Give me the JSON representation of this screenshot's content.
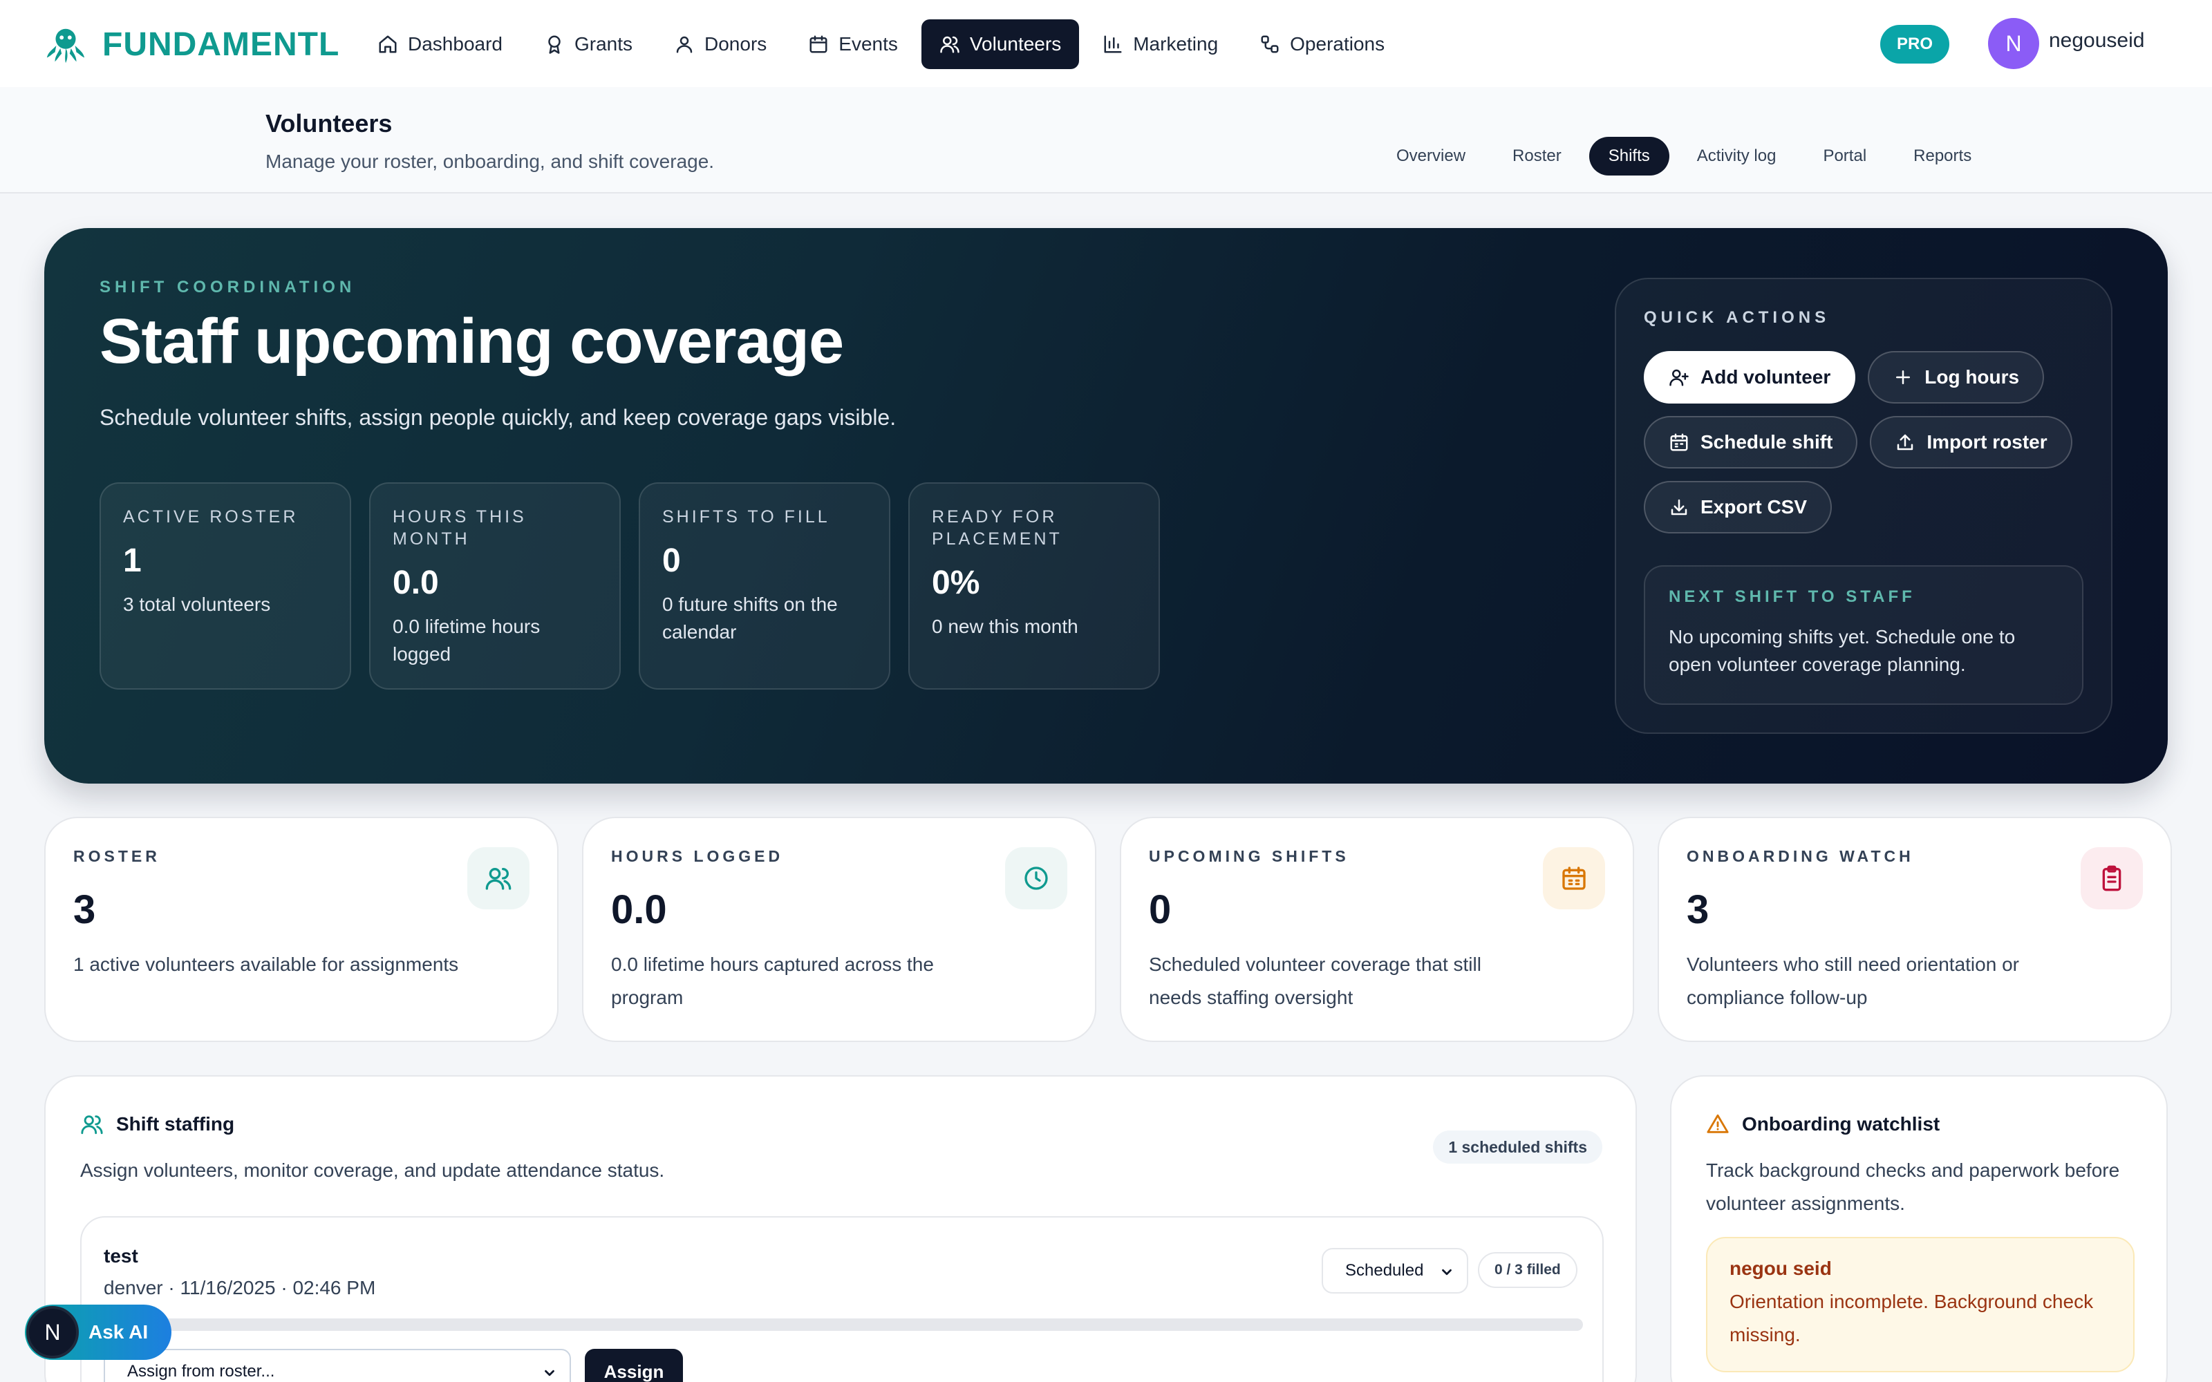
{
  "brand": {
    "name": "FUNDAMENTL",
    "color": "#0f9a8f"
  },
  "nav": {
    "items": [
      {
        "label": "Dashboard",
        "icon": "home-icon"
      },
      {
        "label": "Grants",
        "icon": "award-icon"
      },
      {
        "label": "Donors",
        "icon": "user-icon"
      },
      {
        "label": "Events",
        "icon": "calendar-icon"
      },
      {
        "label": "Volunteers",
        "icon": "users-icon",
        "active": true
      },
      {
        "label": "Marketing",
        "icon": "bar-chart-icon"
      },
      {
        "label": "Operations",
        "icon": "workflow-icon"
      }
    ],
    "pro_badge": "PRO",
    "avatar_initial": "N",
    "username": "negouseid"
  },
  "page": {
    "title": "Volunteers",
    "subtitle": "Manage your roster, onboarding, and shift coverage.",
    "tabs": [
      "Overview",
      "Roster",
      "Shifts",
      "Activity log",
      "Portal",
      "Reports"
    ],
    "active_tab": "Shifts"
  },
  "hero": {
    "eyebrow": "SHIFT COORDINATION",
    "title": "Staff upcoming coverage",
    "description": "Schedule volunteer shifts, assign people quickly, and keep coverage gaps visible.",
    "stats": [
      {
        "label": "ACTIVE ROSTER",
        "value": "1",
        "sub": "3 total volunteers"
      },
      {
        "label": "HOURS THIS MONTH",
        "value": "0.0",
        "sub": "0.0 lifetime hours logged"
      },
      {
        "label": "SHIFTS TO FILL",
        "value": "0",
        "sub": "0 future shifts on the calendar"
      },
      {
        "label": "READY FOR PLACEMENT",
        "value": "0%",
        "sub": "0 new this month"
      }
    ],
    "quick_actions": {
      "title": "QUICK ACTIONS",
      "buttons": {
        "add_volunteer": "Add volunteer",
        "log_hours": "Log hours",
        "schedule_shift": "Schedule shift",
        "import_roster": "Import roster",
        "export_csv": "Export CSV"
      }
    },
    "next_shift": {
      "label": "NEXT SHIFT TO STAFF",
      "text": "No upcoming shifts yet. Schedule one to open volunteer coverage planning."
    }
  },
  "kpis": [
    {
      "label": "ROSTER",
      "value": "3",
      "sub": "1 active volunteers available for assignments",
      "icon": "users-icon",
      "accent": "#0f9a8f"
    },
    {
      "label": "HOURS LOGGED",
      "value": "0.0",
      "sub": "0.0 lifetime hours captured across the program",
      "icon": "clock-icon",
      "accent": "#0f9a8f"
    },
    {
      "label": "UPCOMING SHIFTS",
      "value": "0",
      "sub": "Scheduled volunteer coverage that still needs staffing oversight",
      "icon": "calendar-icon",
      "accent": "#d97706"
    },
    {
      "label": "ONBOARDING WATCH",
      "value": "3",
      "sub": "Volunteers who still need orientation or compliance follow-up",
      "icon": "clipboard-icon",
      "accent": "#be123c"
    }
  ],
  "shift_staffing": {
    "title": "Shift staffing",
    "description": "Assign volunteers, monitor coverage, and update attendance status.",
    "count_label": "1 scheduled shifts",
    "shift": {
      "name": "test",
      "meta": "denver · 11/16/2025 · 02:46 PM",
      "status": "Scheduled",
      "fill_label": "0 / 3 filled",
      "filled_fraction": 0,
      "assign_placeholder": "Assign from roster...",
      "assign_button": "Assign"
    }
  },
  "onboarding_watchlist": {
    "title": "Onboarding watchlist",
    "description": "Track background checks and paperwork before volunteer assignments.",
    "items": [
      {
        "name": "negou seid",
        "message": "Orientation incomplete. Background check missing."
      }
    ]
  },
  "ask_ai": {
    "initial": "N",
    "label": "Ask AI"
  }
}
